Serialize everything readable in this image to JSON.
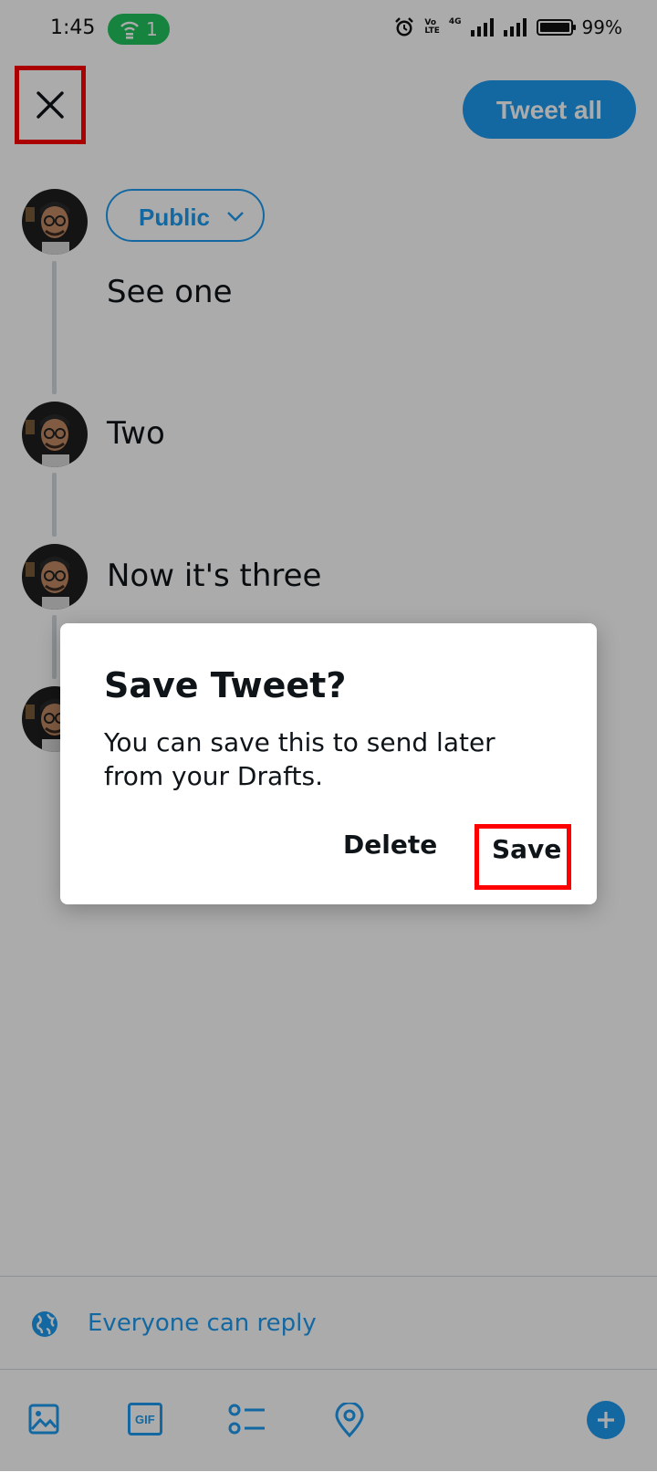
{
  "status_bar": {
    "time": "1:45",
    "hotspot_count": "1",
    "volte_line1": "Vo",
    "volte_line2": "LTE",
    "network": "4G",
    "battery": "99%"
  },
  "header": {
    "close_icon": "close-icon",
    "tweet_all_label": "Tweet all"
  },
  "composer": {
    "audience_label": "Public",
    "tweets": [
      {
        "text": "See one"
      },
      {
        "text": "Two"
      },
      {
        "text": "Now it's three"
      },
      {
        "text": ""
      }
    ]
  },
  "reply_setting": {
    "icon": "globe-icon",
    "label": "Everyone can reply"
  },
  "toolbar": {
    "icons": [
      "image-icon",
      "gif-icon",
      "poll-icon",
      "location-icon",
      "add-icon"
    ],
    "gif_label": "GIF"
  },
  "dialog": {
    "title": "Save Tweet?",
    "body": "You can save this to send later from your Drafts.",
    "delete_label": "Delete",
    "save_label": "Save"
  },
  "colors": {
    "accent": "#1d9bf0",
    "highlight": "#ff0000",
    "hotspot": "#22c55e",
    "scrim": "rgba(0,0,0,0.33)"
  }
}
